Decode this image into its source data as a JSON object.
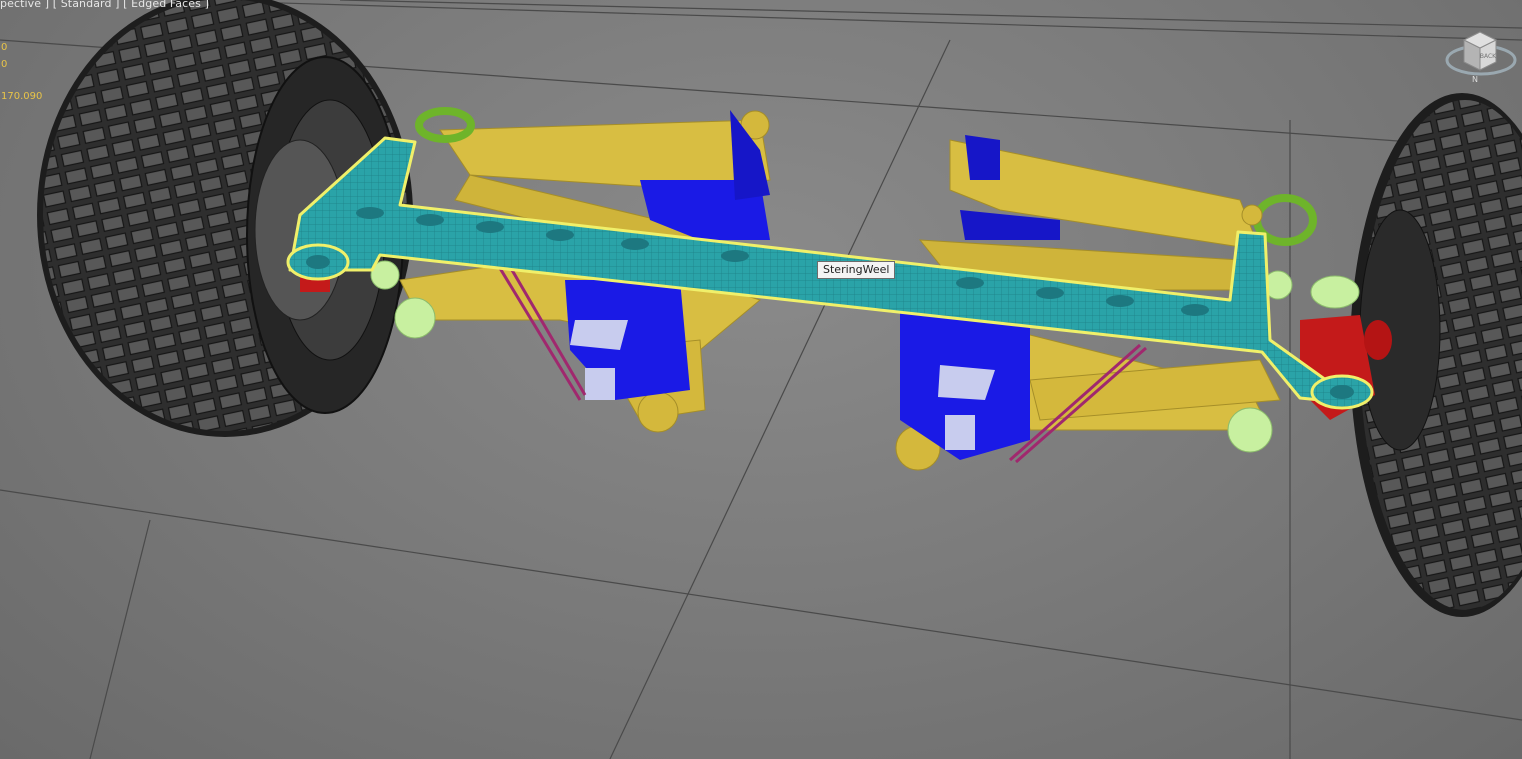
{
  "viewport": {
    "label": "pective ] [ Standard ] [ Edged Faces ]",
    "stats": [
      "0",
      "0",
      "170.090"
    ]
  },
  "viewcube": {
    "faces": [
      "BACK"
    ],
    "compass": "N"
  },
  "tooltip": {
    "object_name": "SteringWeel"
  },
  "colors": {
    "background": "#7c7c7c",
    "grid": "#4a4a4a",
    "tire": "#2e2e2e",
    "selected_bar": "#2aa3a8",
    "selection_outline": "#f0f06a",
    "arms": "#d8be42",
    "knuckles": "#1a1ae6",
    "bushings": "#c8f0a0",
    "springs": "#a0286e",
    "hub": "#c41a1a",
    "stats_text": "#e8c448"
  },
  "icons": [
    "viewcube-icon",
    "compass-ring-icon"
  ]
}
